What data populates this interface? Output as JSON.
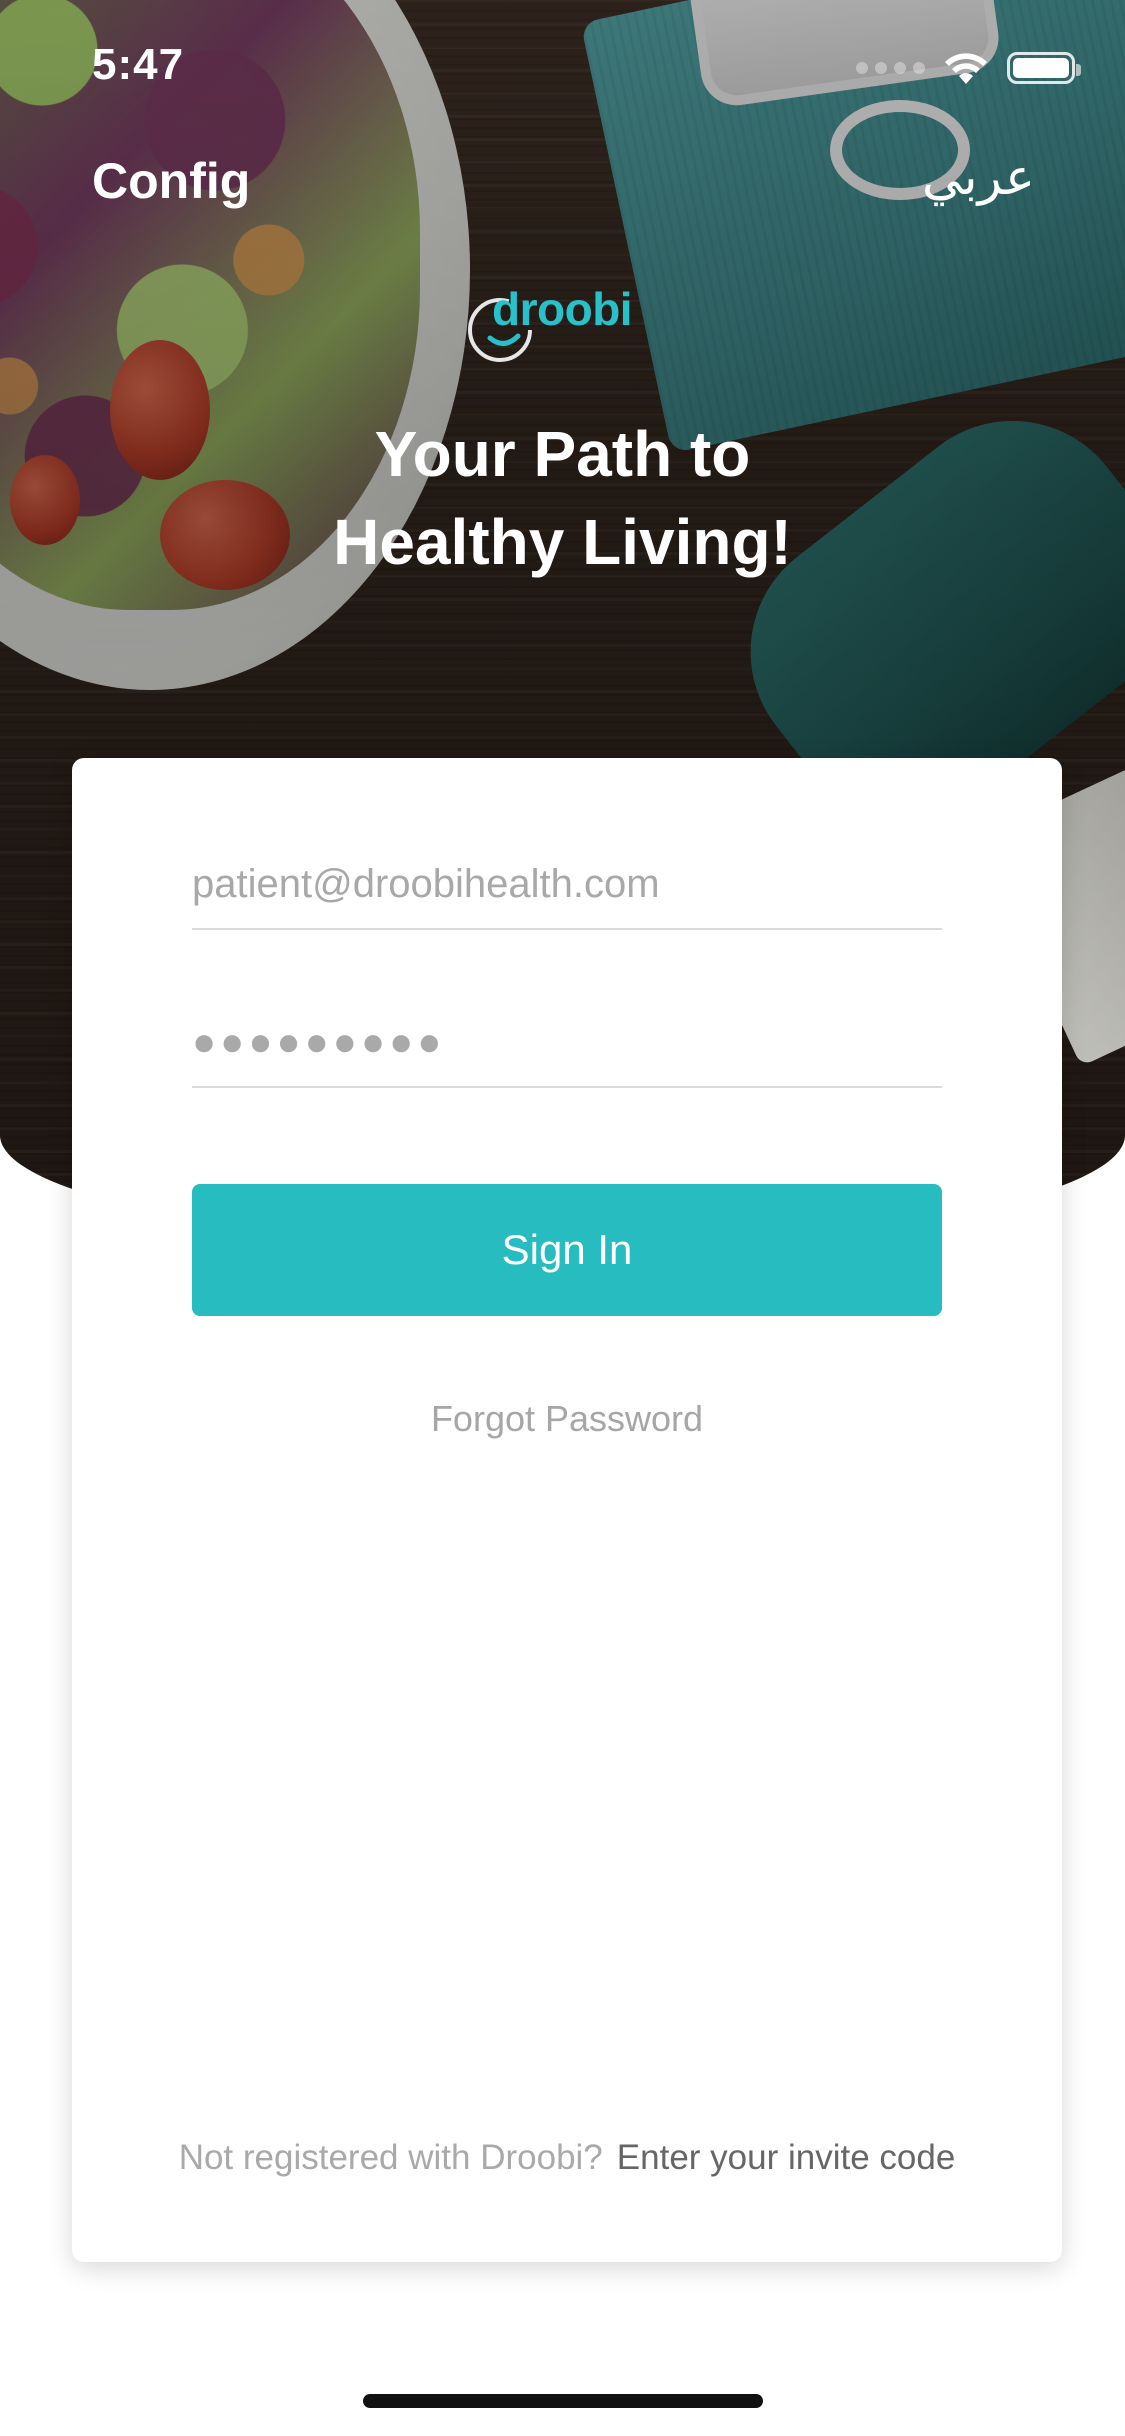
{
  "status_bar": {
    "time": "5:47"
  },
  "header": {
    "config_label": "Config",
    "language_label": "عربي"
  },
  "brand": {
    "logo_text": "droobi",
    "accent_color": "#28c1c9"
  },
  "hero": {
    "tagline_line1": "Your Path to",
    "tagline_line2": "Healthy Living!"
  },
  "login_form": {
    "email_placeholder": "patient@droobihealth.com",
    "password_dots": "●●●●●●●●●",
    "sign_in_label": "Sign In",
    "forgot_password_label": "Forgot Password",
    "button_color": "#27bcc0"
  },
  "footer": {
    "not_registered_text": "Not registered with Droobi?",
    "invite_link_text": "Enter your invite code"
  }
}
